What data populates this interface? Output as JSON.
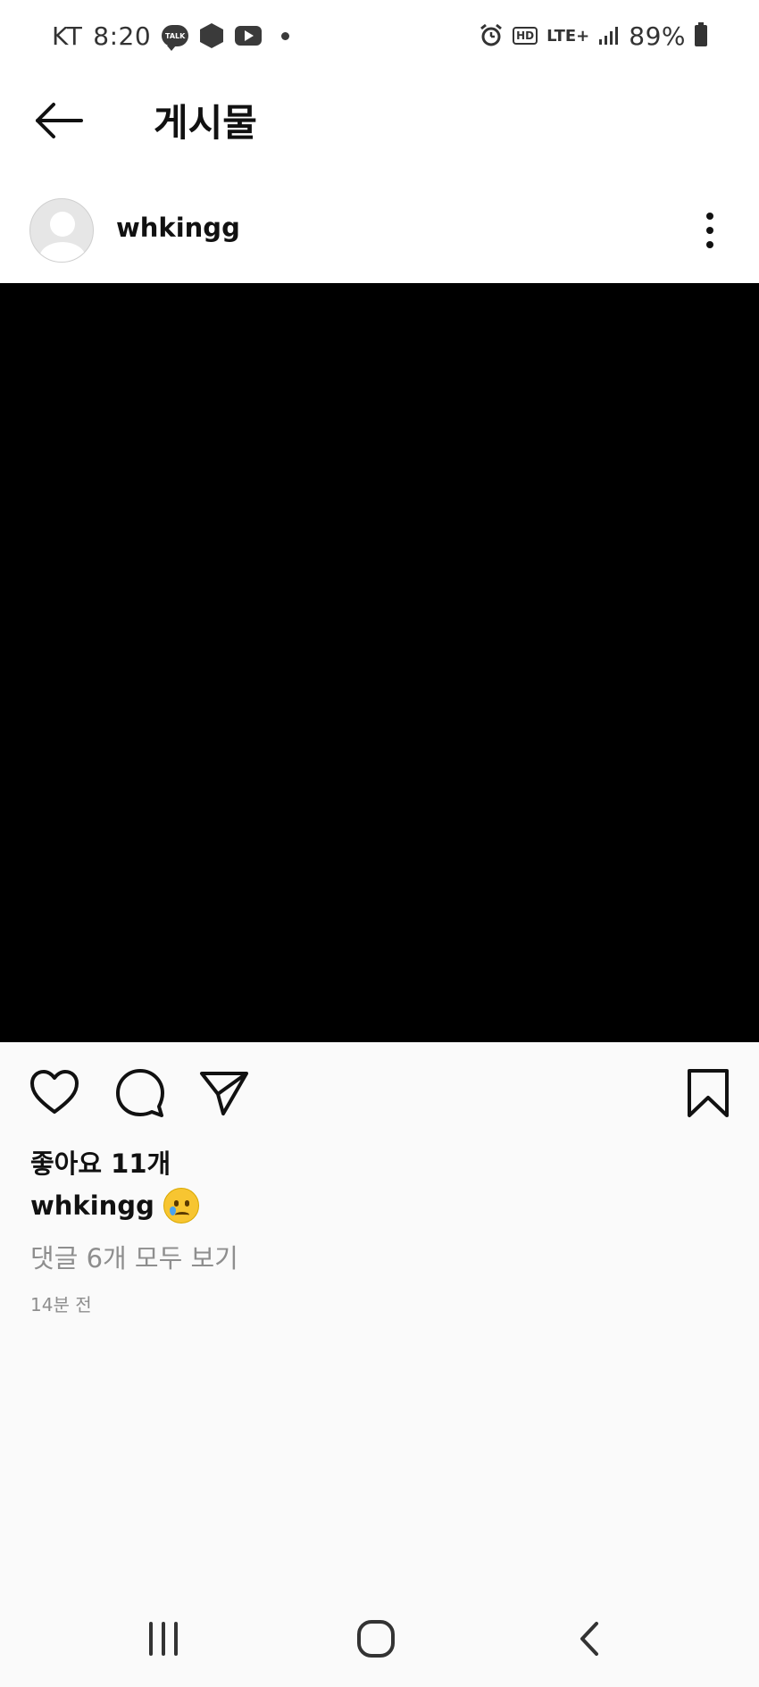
{
  "status_bar": {
    "carrier": "KT",
    "time": "8:20",
    "talk_badge": "TALK",
    "hd_badge": "HD",
    "network": "LTE+",
    "battery": "89%"
  },
  "header": {
    "title": "게시물"
  },
  "post": {
    "username": "whkingg",
    "likes": "좋아요 11개",
    "caption_user": "whkingg",
    "view_comments": "댓글 6개 모두 보기",
    "timestamp": "14분 전"
  },
  "icons": {
    "back": "arrow-left-icon",
    "more": "more-vertical-icon",
    "like": "heart-icon",
    "comment": "comment-icon",
    "share": "send-icon",
    "save": "bookmark-icon",
    "emoji": "crying-face-icon"
  }
}
